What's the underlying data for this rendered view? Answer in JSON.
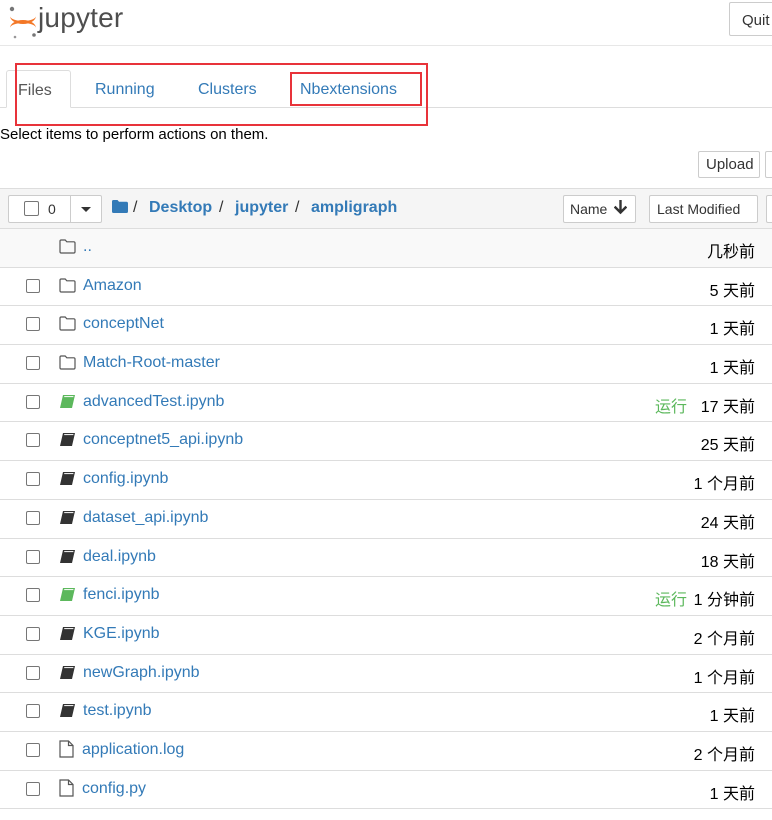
{
  "header": {
    "logo_text": "jupyter",
    "quit_label": "Quit"
  },
  "tabs": [
    {
      "label": "Files"
    },
    {
      "label": "Running"
    },
    {
      "label": "Clusters"
    },
    {
      "label": "Nbextensions"
    }
  ],
  "toolbar": {
    "hint": "Select items to perform actions on them.",
    "upload_label": "Upload"
  },
  "list_header": {
    "selected_count": "0",
    "breadcrumb": [
      "Desktop",
      "jupyter",
      "ampligraph"
    ],
    "sort_name_label": "Name",
    "sort_modified_label": "Last Modified"
  },
  "files": [
    {
      "name": "..",
      "type": "folder",
      "running": "",
      "modified": "几秒前",
      "checkbox": false
    },
    {
      "name": "Amazon",
      "type": "folder",
      "running": "",
      "modified": "5 天前",
      "checkbox": true
    },
    {
      "name": "conceptNet",
      "type": "folder",
      "running": "",
      "modified": "1 天前",
      "checkbox": true
    },
    {
      "name": "Match-Root-master",
      "type": "folder",
      "running": "",
      "modified": "1 天前",
      "checkbox": true
    },
    {
      "name": "advancedTest.ipynb",
      "type": "notebook-running",
      "running": "运行",
      "modified": "17 天前",
      "checkbox": true
    },
    {
      "name": "conceptnet5_api.ipynb",
      "type": "notebook",
      "running": "",
      "modified": "25 天前",
      "checkbox": true
    },
    {
      "name": "config.ipynb",
      "type": "notebook",
      "running": "",
      "modified": "1 个月前",
      "checkbox": true
    },
    {
      "name": "dataset_api.ipynb",
      "type": "notebook",
      "running": "",
      "modified": "24 天前",
      "checkbox": true
    },
    {
      "name": "deal.ipynb",
      "type": "notebook",
      "running": "",
      "modified": "18 天前",
      "checkbox": true
    },
    {
      "name": "fenci.ipynb",
      "type": "notebook-running",
      "running": "运行",
      "modified": "1 分钟前",
      "checkbox": true
    },
    {
      "name": "KGE.ipynb",
      "type": "notebook",
      "running": "",
      "modified": "2 个月前",
      "checkbox": true
    },
    {
      "name": "newGraph.ipynb",
      "type": "notebook",
      "running": "",
      "modified": "1 个月前",
      "checkbox": true
    },
    {
      "name": "test.ipynb",
      "type": "notebook",
      "running": "",
      "modified": "1 天前",
      "checkbox": true
    },
    {
      "name": "application.log",
      "type": "file",
      "running": "",
      "modified": "2 个月前",
      "checkbox": true
    },
    {
      "name": "config.py",
      "type": "file",
      "running": "",
      "modified": "1 天前",
      "checkbox": true
    }
  ],
  "colors": {
    "link": "#337ab7",
    "running": "#5cb85c",
    "highlight": "#e8333a",
    "logo_orange": "#f37726"
  }
}
